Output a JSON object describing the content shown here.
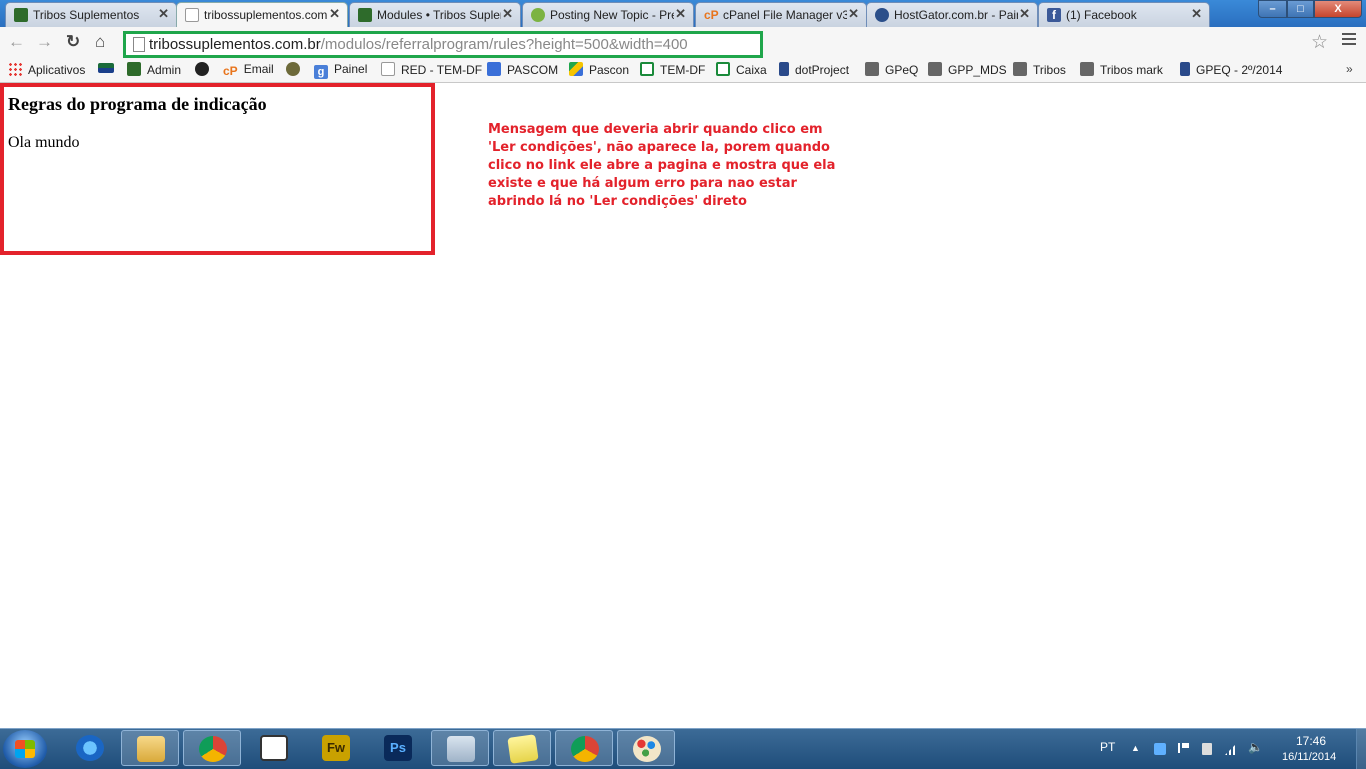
{
  "tabs": [
    {
      "title": "Tribos Suplementos",
      "icon": "tribos-leaf-icon"
    },
    {
      "title": "tribossuplementos.com.br",
      "icon": "page-icon",
      "active": true
    },
    {
      "title": "Modules • Tribos Suplementos",
      "icon": "tribos-leaf-icon"
    },
    {
      "title": "Posting New Topic - PrestaShop",
      "icon": "prestashop-icon"
    },
    {
      "title": "cPanel File Manager v3",
      "icon": "cpanel-icon"
    },
    {
      "title": "HostGator.com.br - Painel",
      "icon": "hostgator-icon"
    },
    {
      "title": "(1) Facebook",
      "icon": "facebook-icon"
    }
  ],
  "window": {
    "minimize": "–",
    "maximize": "□",
    "close": "X"
  },
  "toolbar": {
    "back": "←",
    "forward": "→",
    "reload": "↻",
    "home": "⌂",
    "url_host": "tribossuplementos.com.br",
    "url_path": "/modulos/referralprogram/rules?height=500&width=400",
    "star": "☆"
  },
  "bookmarks": [
    {
      "label": "Aplicativos",
      "icon": "apps-grid-icon"
    },
    {
      "label": "",
      "icon": "flag-icon"
    },
    {
      "label": "Admin",
      "icon": "tribos-leaf-icon"
    },
    {
      "label": "",
      "icon": "github-icon"
    },
    {
      "label": "Email",
      "icon": "cpanel-icon"
    },
    {
      "label": "",
      "icon": "hostgator-icon"
    },
    {
      "label": "Painel",
      "icon": "google-icon"
    },
    {
      "label": "RED - TEM-DF",
      "icon": "document-icon"
    },
    {
      "label": "PASCOM",
      "icon": "person-icon"
    },
    {
      "label": "Pascon",
      "icon": "drive-icon"
    },
    {
      "label": "TEM-DF",
      "icon": "sheet-icon"
    },
    {
      "label": "Caixa",
      "icon": "sheet-icon"
    },
    {
      "label": "dotProject",
      "icon": "dotproject-icon"
    },
    {
      "label": "GPeQ",
      "icon": "folder-icon"
    },
    {
      "label": "GPP_MDS",
      "icon": "folder-icon"
    },
    {
      "label": "Tribos",
      "icon": "folder-icon"
    },
    {
      "label": "Tribos  mark",
      "icon": "folder-icon"
    },
    {
      "label": "GPEQ - 2º/2014",
      "icon": "dotproject-icon"
    }
  ],
  "bookmarks_more": "»",
  "page": {
    "heading": "Regras do programa de indicação",
    "body": "Ola mundo"
  },
  "annotation": {
    "text": "Mensagem que deveria abrir quando clico em 'Ler condições', não aparece la, porem quando clico no link ele abre a pagina e mostra que ela existe e que há algum erro para nao estar abrindo lá no 'Ler condições' direto",
    "color": "#e3222b"
  },
  "highlight_colors": {
    "page_box": "#e3222b",
    "url_box": "#1fa64b"
  },
  "taskbar": {
    "apps": [
      "ie-icon",
      "explorer-icon",
      "chrome-icon",
      "media-player-icon",
      "fireworks-icon",
      "photoshop-icon",
      "calculator-icon",
      "sticky-notes-icon",
      "chrome-icon",
      "paint-icon"
    ],
    "fireworks_label": "Fw",
    "photoshop_label": "Ps",
    "language": "PT",
    "time": "17:46",
    "date": "16/11/2014"
  }
}
